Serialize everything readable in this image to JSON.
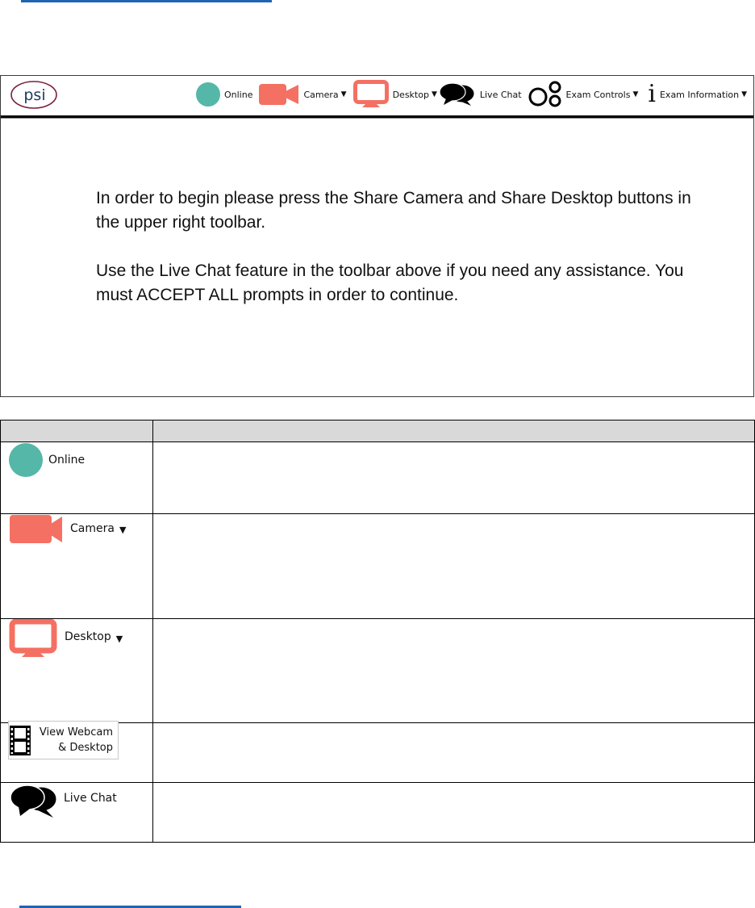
{
  "colors": {
    "link_blue": "#1f63b5",
    "online_teal": "#55b7a8",
    "coral": "#f47063",
    "psi_maroon": "#7a1f3d",
    "psi_text": "#1d3a5c",
    "header_gray": "#d9d9d9"
  },
  "app": {
    "logo_text": "psi",
    "toolbar": {
      "items": [
        {
          "icon": "status-circle-icon",
          "label": "Online",
          "has_caret": false
        },
        {
          "icon": "video-camera-icon",
          "label": "Camera",
          "has_caret": true
        },
        {
          "icon": "monitor-icon",
          "label": "Desktop",
          "has_caret": true
        },
        {
          "icon": "chat-bubbles-icon",
          "label": "Live Chat",
          "has_caret": false
        },
        {
          "icon": "exam-controls-icon",
          "label": "Exam Controls",
          "has_caret": true
        },
        {
          "icon": "info-icon",
          "label": "Exam Information",
          "has_caret": true
        }
      ],
      "caret": "▼"
    },
    "instructions": [
      "In order to begin please press the Share Camera and Share Desktop buttons in the upper right toolbar.",
      "Use the Live Chat feature in the toolbar above if you need any assistance. You must ACCEPT ALL prompts in order to continue."
    ]
  },
  "legend_table": {
    "headers": [
      "",
      ""
    ],
    "rows": [
      {
        "icon": "status-circle-icon",
        "label": "Online",
        "caret": "",
        "description": ""
      },
      {
        "icon": "video-camera-icon",
        "label": "Camera",
        "caret": "▼",
        "description": ""
      },
      {
        "icon": "monitor-icon",
        "label": "Desktop",
        "caret": "▼",
        "description": ""
      },
      {
        "icon": "film-strip-icon",
        "label_line1": "View Webcam",
        "label_line2": "& Desktop",
        "description": ""
      },
      {
        "icon": "chat-bubbles-icon",
        "label": "Live Chat",
        "caret": "",
        "description": ""
      }
    ]
  }
}
